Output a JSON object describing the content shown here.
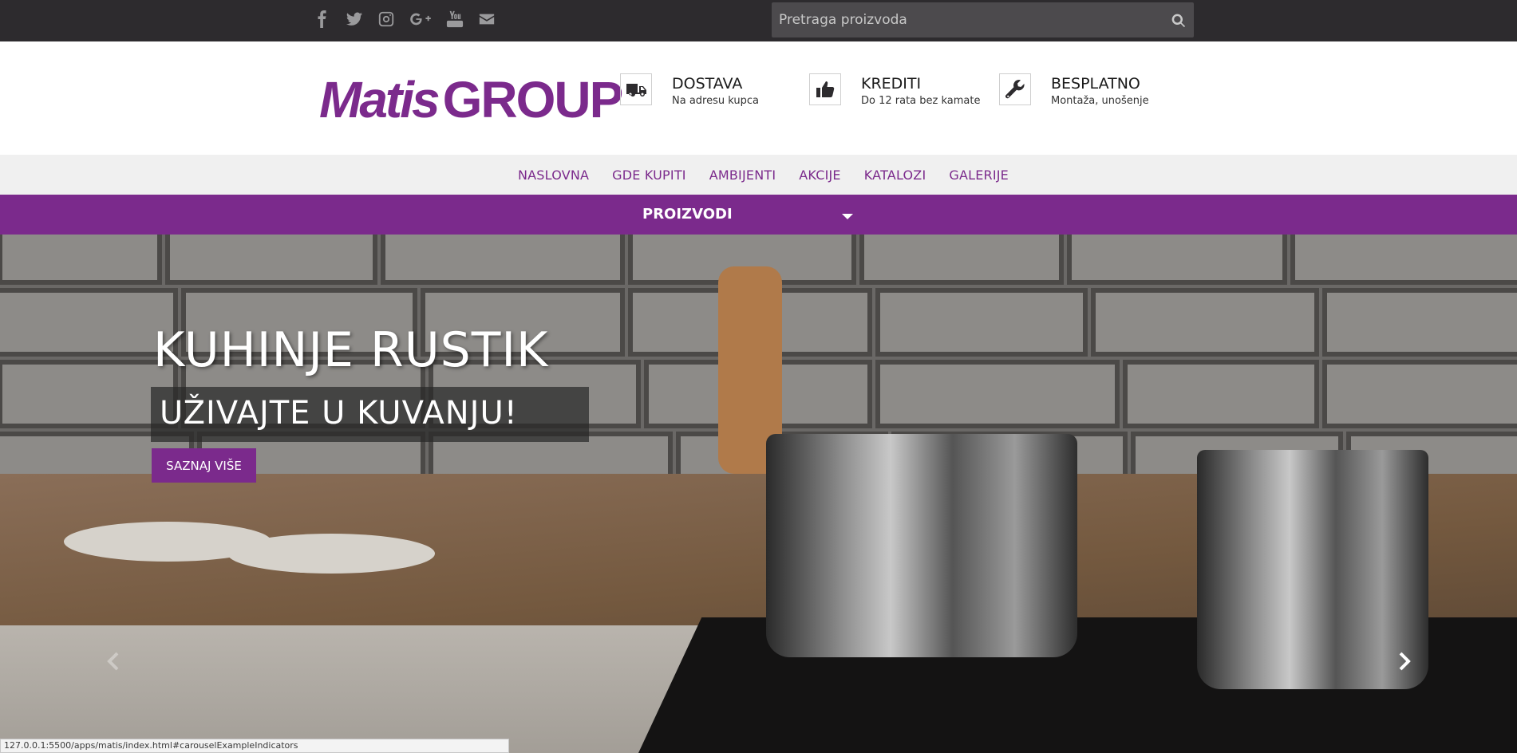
{
  "topbar": {
    "social_icons": [
      "facebook-icon",
      "twitter-icon",
      "instagram-icon",
      "google-plus-icon",
      "youtube-icon",
      "envelope-icon"
    ],
    "search": {
      "placeholder": "Pretraga proizvoda",
      "value": "",
      "button_icon": "search-icon"
    }
  },
  "header": {
    "logo_part1": "Matis",
    "logo_part2": "GROUP",
    "features": [
      {
        "icon": "truck-icon",
        "title": "DOSTAVA",
        "subtitle": "Na adresu kupca"
      },
      {
        "icon": "thumbs-up-icon",
        "title": "KREDITI",
        "subtitle": "Do 12 rata bez kamate"
      },
      {
        "icon": "wrench-icon",
        "title": "BESPLATNO",
        "subtitle": "Montaža, unošenje"
      }
    ]
  },
  "nav": {
    "items": [
      "NASLOVNA",
      "GDE KUPITI",
      "AMBIJENTI",
      "AKCIJE",
      "KATALOZI",
      "GALERIJE"
    ]
  },
  "products_bar": {
    "label": "PROIZVODI",
    "dropdown_icon": "caret-down-icon"
  },
  "hero": {
    "title": "KUHINJE RUSTIK",
    "subtitle": "UŽIVAJTE U KUVANJU!",
    "button_label": "SAZNAJ VIŠE",
    "prev_icon": "chevron-left-icon",
    "next_icon": "chevron-right-icon"
  },
  "status_bar": {
    "url": "127.0.0.1:5500/apps/matis/index.html#carouselExampleIndicators"
  },
  "colors": {
    "brand_purple": "#7b2a8c",
    "topbar_bg": "#2d2b2e",
    "nav_bg": "#f0f0f0"
  }
}
